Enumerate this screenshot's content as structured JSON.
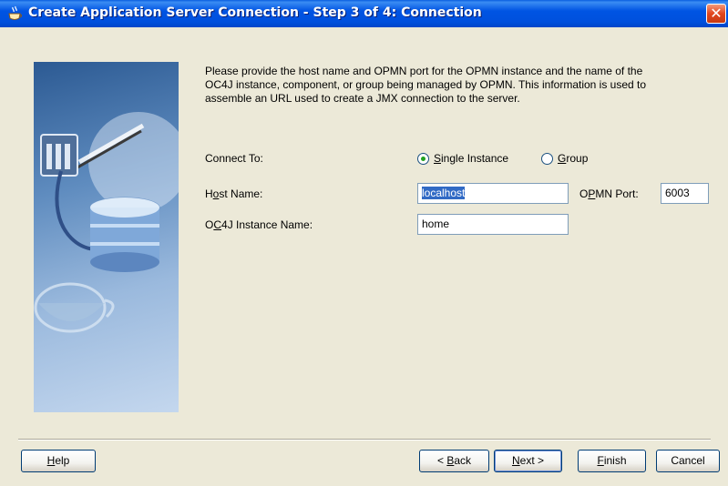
{
  "window": {
    "title": "Create Application Server Connection - Step 3 of 4: Connection",
    "title_icon": "coffee-cup-icon",
    "close_icon": "close-icon",
    "close_glyph": "✕"
  },
  "instructions": "Please provide the host name and OPMN port for the OPMN instance and the name of the OC4J instance, component, or group being managed by OPMN. This information is used to assemble an URL used to create a JMX connection to the server.",
  "connect_to": {
    "label": "Connect To:",
    "options": [
      {
        "mnemonic": "S",
        "rest": "ingle Instance",
        "selected": true
      },
      {
        "mnemonic": "G",
        "rest": "roup",
        "selected": false
      }
    ]
  },
  "host_name": {
    "label_pre": "H",
    "label_mnemonic": "o",
    "label_post": "st Name:",
    "value": "localhost",
    "value_selected": true
  },
  "opmn_port": {
    "label_pre": "O",
    "label_mnemonic": "P",
    "label_post": "MN Port:",
    "value": "6003"
  },
  "oc4j_instance": {
    "label_pre": "O",
    "label_mnemonic": "C",
    "label_post": "4J Instance Name:",
    "value": "home"
  },
  "buttons": {
    "help": {
      "mnemonic": "H",
      "rest": "elp"
    },
    "back": {
      "pre": "< ",
      "mnemonic": "B",
      "rest": "ack"
    },
    "next": {
      "mnemonic": "N",
      "rest": "ext >"
    },
    "finish": {
      "mnemonic": "F",
      "rest": "inish"
    },
    "cancel": {
      "label": "Cancel"
    }
  },
  "colors": {
    "title_bar": "#0054e3",
    "selection": "#316ac5",
    "dialog_bg": "#ece9d8"
  }
}
